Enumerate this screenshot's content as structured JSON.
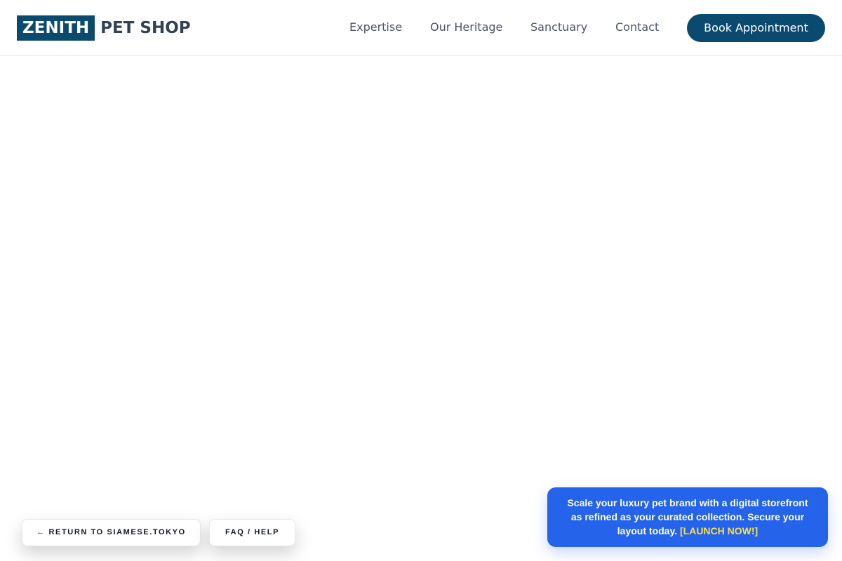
{
  "header": {
    "logo_mark": "ZENITH",
    "logo_text": "PET SHOP",
    "nav": {
      "expertise": "Expertise",
      "heritage": "Our Heritage",
      "sanctuary": "Sanctuary",
      "contact": "Contact"
    },
    "cta_label": "Book Appointment"
  },
  "footer_actions": {
    "return_label": "← RETURN TO SIAMESE.TOKYO",
    "faq_label": "FAQ / HELP"
  },
  "promo": {
    "message": "Scale your luxury pet brand with a digital storefront as refined as your curated collection. Secure your layout today. ",
    "cta": "[LAUNCH NOW!]"
  },
  "colors": {
    "brand_navy": "#0b4a6f",
    "promo_blue": "#2563eb",
    "promo_cta_yellow": "#fde047",
    "nav_text": "#4b5563"
  }
}
